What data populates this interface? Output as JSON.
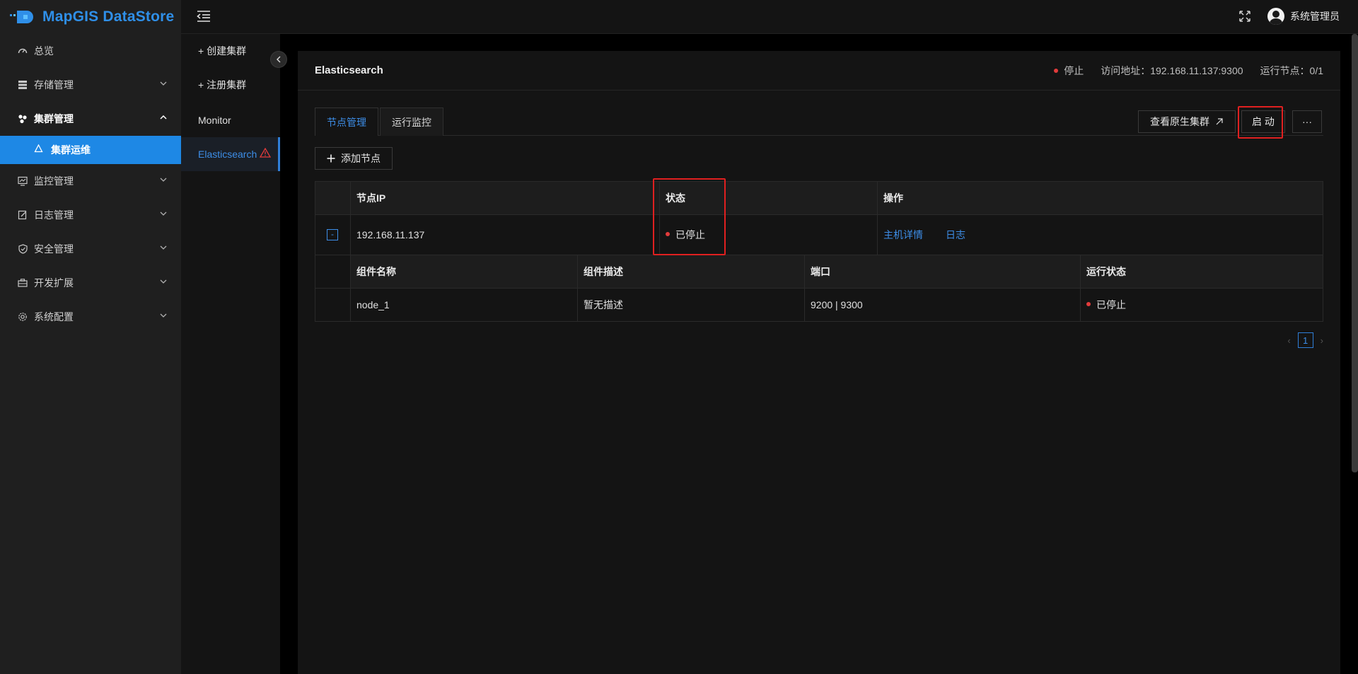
{
  "app": {
    "logo_text": "MapGIS DataStore"
  },
  "sidebar": {
    "items": [
      {
        "label": "总览",
        "icon": "dashboard-icon",
        "has_children": false
      },
      {
        "label": "存储管理",
        "icon": "storage-icon",
        "has_children": true
      },
      {
        "label": "集群管理",
        "icon": "cluster-icon",
        "has_children": true,
        "open": true
      },
      {
        "label": "监控管理",
        "icon": "monitor-icon",
        "has_children": true
      },
      {
        "label": "日志管理",
        "icon": "log-icon",
        "has_children": true
      },
      {
        "label": "安全管理",
        "icon": "shield-icon",
        "has_children": true
      },
      {
        "label": "开发扩展",
        "icon": "extension-icon",
        "has_children": true
      },
      {
        "label": "系统配置",
        "icon": "gear-icon",
        "has_children": true
      }
    ],
    "sub_item": {
      "label": "集群运维",
      "icon": "recycle-icon"
    }
  },
  "cluster_menu": {
    "items": [
      {
        "label": "+ 创建集群"
      },
      {
        "label": "+ 注册集群"
      },
      {
        "label": "Monitor"
      },
      {
        "label": "Elasticsearch",
        "active": true,
        "warning": true
      }
    ]
  },
  "header": {
    "user_name": "系统管理员"
  },
  "card": {
    "title": "Elasticsearch",
    "status": "停止",
    "access_address": "访问地址：192.168.11.137:9300",
    "running_nodes": "运行节点：0/1",
    "tabs": [
      {
        "label": "节点管理",
        "active": true
      },
      {
        "label": "运行监控",
        "active": false
      }
    ],
    "view_native_cluster": "查看原生集群",
    "start_button": "启 动",
    "more_button": "···",
    "add_node": "添加节点"
  },
  "node_table": {
    "headers": [
      "节点IP",
      "状态",
      "操作"
    ],
    "rows": [
      {
        "ip": "192.168.11.137",
        "status": "已停止",
        "actions": [
          "主机详情",
          "日志"
        ]
      }
    ],
    "component_headers": [
      "组件名称",
      "组件描述",
      "端口",
      "运行状态"
    ],
    "components": [
      {
        "name": "node_1",
        "desc": "暂无描述",
        "port": "9200 | 9300",
        "status": "已停止"
      }
    ]
  },
  "pagination": {
    "current": "1",
    "prev": "‹",
    "next": "›"
  },
  "colors": {
    "accent": "#1e88e5",
    "link": "#3d8ee8",
    "danger": "#e02020",
    "status_stopped": "#e23b3b"
  }
}
